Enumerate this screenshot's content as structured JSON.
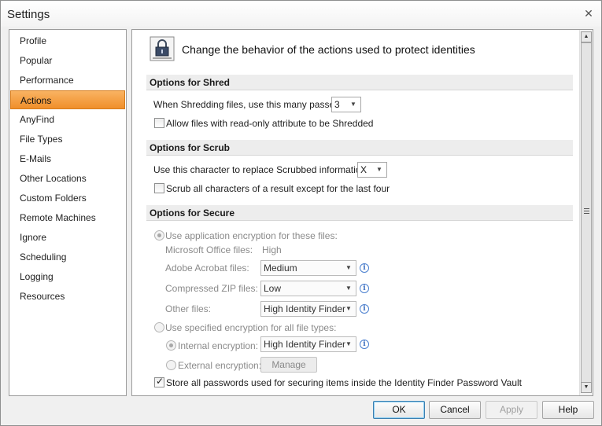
{
  "window": {
    "title": "Settings",
    "close_glyph": "✕"
  },
  "sidebar": {
    "items": [
      {
        "label": "Profile"
      },
      {
        "label": "Popular"
      },
      {
        "label": "Performance"
      },
      {
        "label": "Actions",
        "active": true
      },
      {
        "label": "AnyFind"
      },
      {
        "label": "File Types"
      },
      {
        "label": "E-Mails"
      },
      {
        "label": "Other Locations"
      },
      {
        "label": "Custom Folders"
      },
      {
        "label": "Remote Machines"
      },
      {
        "label": "Ignore"
      },
      {
        "label": "Scheduling"
      },
      {
        "label": "Logging"
      },
      {
        "label": "Resources"
      }
    ]
  },
  "header": {
    "icon": "lock-icon",
    "text": "Change the behavior of the actions used to protect identities"
  },
  "shred": {
    "title": "Options for Shred",
    "passes_label": "When Shredding files, use this many passes:",
    "passes_value": "3",
    "readonly_label": "Allow files with read-only attribute to be Shredded",
    "readonly_checked": false
  },
  "scrub": {
    "title": "Options for Scrub",
    "char_label": "Use this character to replace Scrubbed information:",
    "char_value": "X",
    "all_chars_label": "Scrub all characters of a result except for the last four",
    "all_chars_checked": false
  },
  "secure": {
    "title": "Options for Secure",
    "app_enc_label": "Use application encryption for these files:",
    "office_label": "Microsoft Office files:",
    "office_value": "High",
    "acrobat_label": "Adobe Acrobat files:",
    "acrobat_value": "Medium",
    "zip_label": "Compressed ZIP files:",
    "zip_value": "Low",
    "other_label": "Other files:",
    "other_value": "High Identity Finder",
    "spec_enc_label": "Use specified encryption for all file types:",
    "internal_label": "Internal encryption:",
    "internal_value": "High Identity Finder",
    "external_label": "External encryption:",
    "manage_label": "Manage",
    "store_label": "Store all passwords used for securing items inside the Identity Finder Password Vault",
    "store_checked": true
  },
  "buttons": {
    "ok": "OK",
    "cancel": "Cancel",
    "apply": "Apply",
    "help": "Help"
  },
  "glyphs": {
    "dropdown": "▼",
    "info": "i",
    "scroll_up": "▲",
    "scroll_down": "▼"
  }
}
